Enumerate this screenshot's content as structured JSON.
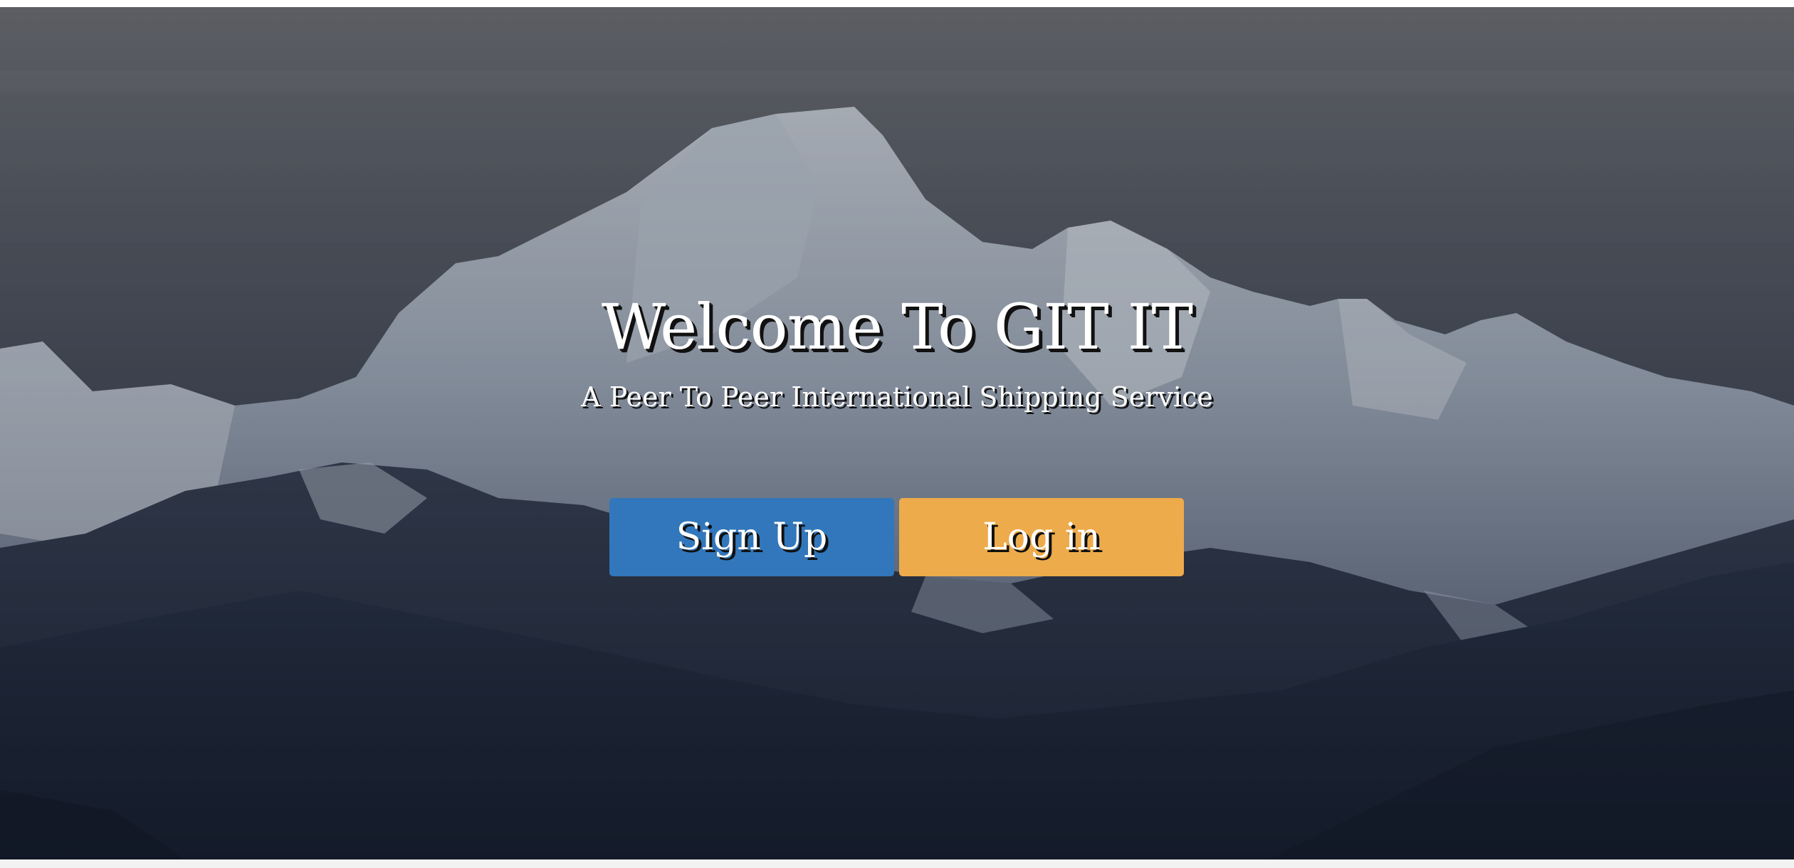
{
  "hero": {
    "title": "Welcome To GIT IT",
    "subtitle": "A Peer To Peer International Shipping Service",
    "background_image": "snow-capped-mountain-range"
  },
  "actions": {
    "signup_label": "Sign Up",
    "login_label": "Log in"
  },
  "colors": {
    "signup_button": "#3277bb",
    "login_button": "#eeab4b",
    "text": "#ffffff"
  }
}
